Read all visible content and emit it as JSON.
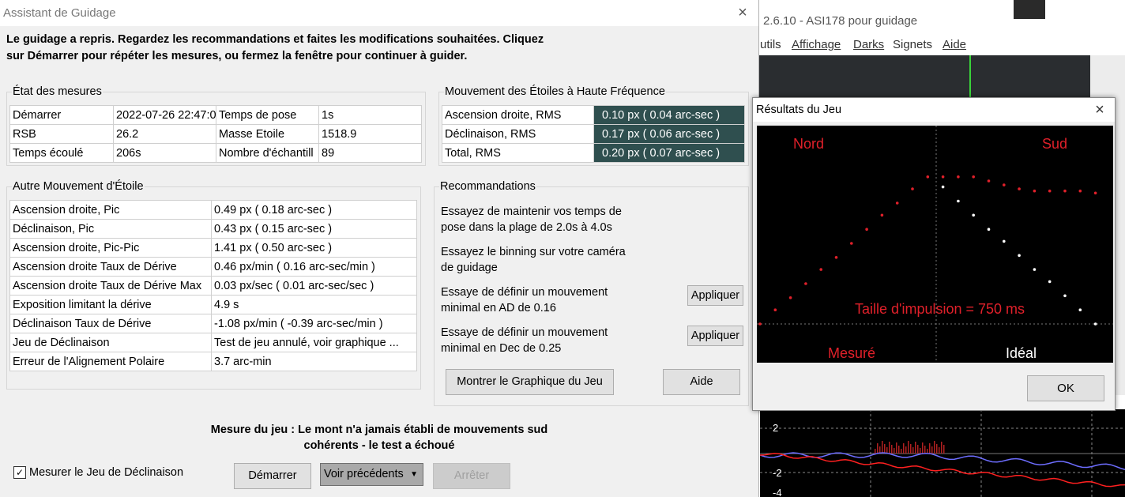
{
  "colors": {
    "dialog_bg": "#f0f0f0",
    "highlight_cell": "#2f4f4f",
    "plot_bg": "#000000",
    "measured_red": "#e0202a",
    "ideal_white": "#ffffff",
    "graph_blue": "#6d6dff"
  },
  "background_window": {
    "title": "2.6.10 - ASI178 pour guidage",
    "menu": [
      "utils",
      "Affichage",
      "Darks",
      "Signets",
      "Aide"
    ],
    "graph": {
      "ticks": [
        "2",
        "-2",
        "-4"
      ]
    }
  },
  "guiding_assistant": {
    "title": "Assistant de Guidage",
    "close_icon": "×",
    "intro_line1": "Le guidage a repris. Regardez les recommandations et faites les modifications souhaitées. Cliquez",
    "intro_line2": "sur Démarrer pour répéter les mesures, ou fermez la fenêtre pour continuer à guider.",
    "measurement_status": {
      "label": "État des mesures",
      "rows": [
        [
          "Démarrer",
          "2022-07-26 22:47:0",
          "Temps de pose",
          "1s"
        ],
        [
          "RSB",
          "26.2",
          "Masse Etoile",
          "1518.9"
        ],
        [
          "Temps écoulé",
          "206s",
          "Nombre d'échantill",
          "89"
        ]
      ]
    },
    "high_frequency": {
      "label": "Mouvement des Étoiles à Haute Fréquence",
      "rows": [
        [
          "Ascension droite, RMS",
          "0.10 px (  0.04 arc-sec )"
        ],
        [
          "Déclinaison, RMS",
          "0.17 px (  0.06 arc-sec )"
        ],
        [
          "Total, RMS",
          "0.20 px (  0.07 arc-sec )"
        ]
      ]
    },
    "other_motion": {
      "label": "Autre Mouvement d'Étoile",
      "rows": [
        [
          "Ascension droite, Pic",
          "0.49 px (  0.18 arc-sec )"
        ],
        [
          "Déclinaison, Pic",
          "0.43 px (  0.15 arc-sec )"
        ],
        [
          "Ascension droite, Pic-Pic",
          "1.41 px (  0.50 arc-sec )"
        ],
        [
          "Ascension droite Taux de Dérive",
          "0.46 px/min (  0.16 arc-sec/min )"
        ],
        [
          "Ascension droite Taux de Dérive Max",
          "0.03 px/sec (  0.01 arc-sec/sec )"
        ],
        [
          "Exposition limitant la dérive",
          "4.9 s"
        ],
        [
          "Déclinaison Taux de Dérive",
          "-1.08 px/min ( -0.39 arc-sec/min )"
        ],
        [
          "Jeu de Déclinaison",
          "Test de jeu annulé, voir graphique ..."
        ],
        [
          "Erreur de l'Alignement Polaire",
          "3.7 arc-min"
        ]
      ]
    },
    "recommendations": {
      "label": "Recommandations",
      "items": [
        {
          "line1": "Essayez de maintenir vos temps de",
          "line2": "pose dans la plage de 2.0s à 4.0s"
        },
        {
          "line1": "Essayez le binning sur votre caméra",
          "line2": "de guidage"
        },
        {
          "line1": "Essaye de définir un mouvement",
          "line2": "minimal en AD de 0.16",
          "button": "Appliquer"
        },
        {
          "line1": "Essaye de définir un mouvement",
          "line2": "minimal en Dec de 0.25",
          "button": "Appliquer"
        }
      ],
      "show_graph_button": "Montrer le Graphique du Jeu",
      "help_button": "Aide"
    },
    "status_line1": "Mesure du jeu : Le mont n'a jamais établi de mouvements sud",
    "status_line2": "cohérents - le test a échoué",
    "checkbox_label": "Mesurer le Jeu de Déclinaison",
    "checkbox_checked": true,
    "checkbox_mark": "✓",
    "buttons": {
      "start": "Démarrer",
      "previous": "Voir précédents",
      "previous_arrow": "▼",
      "stop": "Arrêter"
    }
  },
  "backlash_dialog": {
    "title": "Résultats du Jeu",
    "close_icon": "×",
    "ok_button": "OK",
    "chart_data": {
      "type": "scatter",
      "labels": {
        "north": "Nord",
        "south": "Sud",
        "measured": "Mesuré",
        "ideal": "Idéal",
        "pulse_size": "Taille d'impulsion = 750 ms"
      },
      "series": [
        {
          "name": "Mesuré",
          "color": "#e0202a",
          "x": [
            0,
            1,
            2,
            3,
            4,
            5,
            6,
            7,
            8,
            9,
            10,
            11,
            12,
            13,
            14,
            15,
            16,
            17,
            18,
            19,
            20,
            21,
            22
          ],
          "y": [
            0.0,
            0.07,
            0.13,
            0.2,
            0.27,
            0.33,
            0.4,
            0.47,
            0.54,
            0.6,
            0.67,
            0.73,
            0.73,
            0.73,
            0.73,
            0.71,
            0.69,
            0.67,
            0.66,
            0.66,
            0.66,
            0.66,
            0.65
          ]
        },
        {
          "name": "Idéal",
          "color": "#ffffff",
          "x": [
            12,
            13,
            14,
            15,
            16,
            17,
            18,
            19,
            20,
            21,
            22
          ],
          "y": [
            0.68,
            0.61,
            0.54,
            0.47,
            0.41,
            0.34,
            0.27,
            0.21,
            0.14,
            0.07,
            0.0
          ]
        }
      ]
    }
  }
}
